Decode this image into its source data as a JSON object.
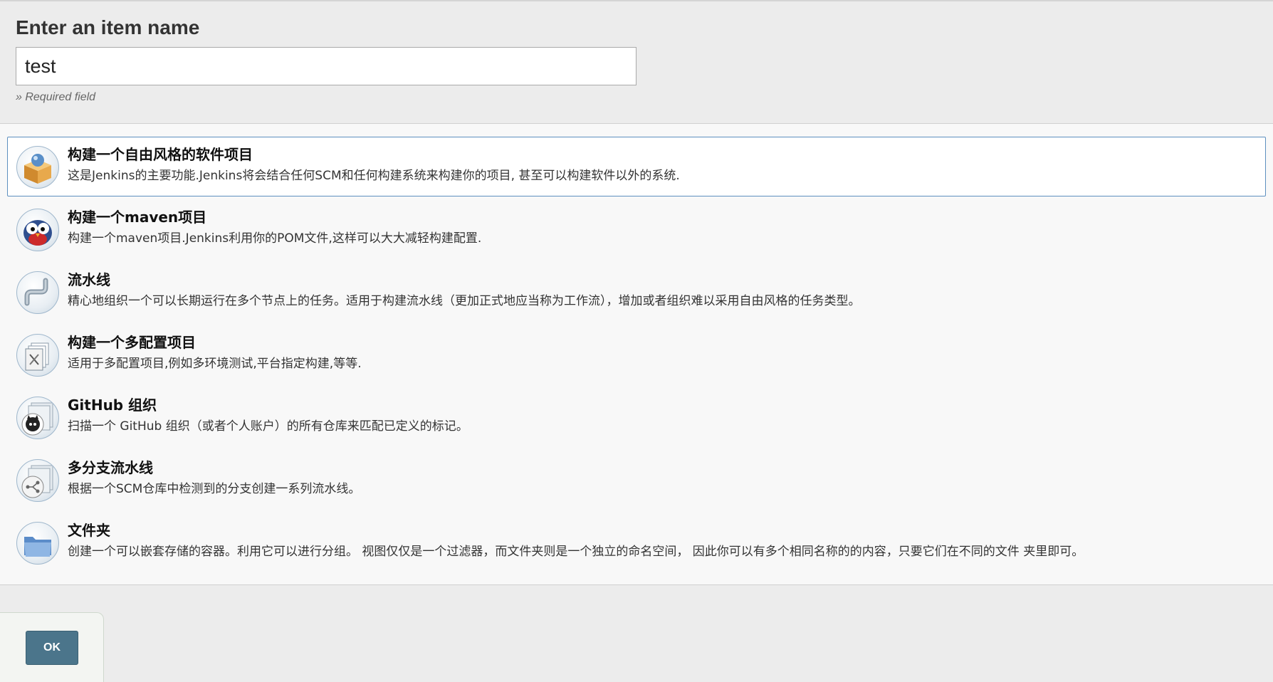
{
  "form": {
    "title": "Enter an item name",
    "name_value": "test",
    "required_hint": "» Required field"
  },
  "item_types": [
    {
      "icon": "freestyle-box-icon",
      "label": "构建一个自由风格的软件项目",
      "description": "这是Jenkins的主要功能.Jenkins将会结合任何SCM和任何构建系统来构建你的项目, 甚至可以构建软件以外的系统.",
      "selected": true
    },
    {
      "icon": "maven-owl-icon",
      "label": "构建一个maven项目",
      "description": "构建一个maven项目.Jenkins利用你的POM文件,这样可以大大减轻构建配置.",
      "selected": false
    },
    {
      "icon": "pipeline-icon",
      "label": "流水线",
      "description": "精心地组织一个可以长期运行在多个节点上的任务。适用于构建流水线（更加正式地应当称为工作流），增加或者组织难以采用自由风格的任务类型。",
      "selected": false
    },
    {
      "icon": "multi-config-icon",
      "label": "构建一个多配置项目",
      "description": "适用于多配置项目,例如多环境测试,平台指定构建,等等.",
      "selected": false
    },
    {
      "icon": "github-org-icon",
      "label": "GitHub 组织",
      "description": "扫描一个 GitHub 组织（或者个人账户）的所有仓库来匹配已定义的标记。",
      "selected": false
    },
    {
      "icon": "multibranch-pipeline-icon",
      "label": "多分支流水线",
      "description": "根据一个SCM仓库中检测到的分支创建一系列流水线。",
      "selected": false
    },
    {
      "icon": "folder-icon",
      "label": "文件夹",
      "description": "创建一个可以嵌套存储的容器。利用它可以进行分组。 视图仅仅是一个过滤器，而文件夹则是一个独立的命名空间， 因此你可以有多个相同名称的的内容，只要它们在不同的文件 夹里即可。",
      "selected": false
    }
  ],
  "actions": {
    "ok_label": "OK"
  },
  "colors": {
    "accent_border": "#5d8fbf",
    "ok_button_bg": "#4b758b"
  }
}
